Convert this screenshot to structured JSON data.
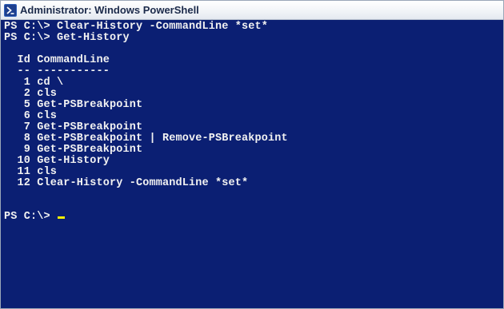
{
  "window": {
    "title": "Administrator: Windows PowerShell",
    "icon": "powershell-icon"
  },
  "console": {
    "lines": [
      "PS C:\\> Clear-History -CommandLine *set*",
      "PS C:\\> Get-History",
      "",
      "  Id CommandLine",
      "  -- -----------",
      "   1 cd \\",
      "   2 cls",
      "   5 Get-PSBreakpoint",
      "   6 cls",
      "   7 Get-PSBreakpoint",
      "   8 Get-PSBreakpoint | Remove-PSBreakpoint",
      "   9 Get-PSBreakpoint",
      "  10 Get-History",
      "  11 cls",
      "  12 Clear-History -CommandLine *set*",
      "",
      "",
      "PS C:\\> "
    ]
  },
  "colors": {
    "console_background": "#0b1f73",
    "console_text": "#f2f2f2",
    "cursor": "#f5f000",
    "titlebar_text": "#1b2a4a"
  }
}
